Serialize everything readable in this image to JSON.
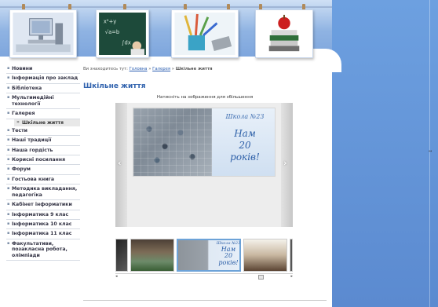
{
  "colors": {
    "accent_title": "#3163ae",
    "link": "#2a5db0",
    "background_blue": "#6b98d6"
  },
  "header": {
    "images": [
      "computer-icon",
      "chalkboard-icon",
      "pencils-icon",
      "books-apple-icon"
    ]
  },
  "sidebar": {
    "items": [
      {
        "label": "Новини"
      },
      {
        "label": "Інформація про заклад"
      },
      {
        "label": "Бібліотека"
      },
      {
        "label": "Мультимедійні технології"
      },
      {
        "label": "Галерея"
      },
      {
        "label": "Шкільне життя",
        "sub": true
      },
      {
        "label": "Тести"
      },
      {
        "label": "Наші традиції"
      },
      {
        "label": "Наша гордість"
      },
      {
        "label": "Корисні посилання"
      },
      {
        "label": "Форум"
      },
      {
        "label": "Гостьова книга"
      },
      {
        "label": "Методика викладання, педагогіка"
      },
      {
        "label": "Кабінет інформатики"
      },
      {
        "label": "Інформатика 9 клас"
      },
      {
        "label": "Інформатика 10 клас"
      },
      {
        "label": "Інформатика 11 клас"
      },
      {
        "label": "Факультативи, позакласна робота, олімпіади"
      }
    ]
  },
  "breadcrumb": {
    "prefix": "Ви знаходитесь тут:",
    "home": "Головна",
    "gallery": "Галерея",
    "current": "Шкільне життя",
    "sep": "»"
  },
  "content": {
    "title": "Шкільне життя",
    "hint": "Натисніть на зображення для збільшення",
    "main_image": {
      "school": "Школа №23",
      "line1": "Нам",
      "line2": "20",
      "line3": "років!"
    },
    "thumb_text": {
      "school": "Школа №23",
      "line1": "Нам",
      "line2": "20",
      "line3": "років!"
    }
  },
  "gallery": {
    "prev_icon": "chevron-left-icon",
    "next_icon": "chevron-right-icon",
    "prev_glyph": "‹",
    "next_glyph": "›",
    "scroll_left": "◂",
    "scroll_right": "▸"
  },
  "right_marker": "↔"
}
